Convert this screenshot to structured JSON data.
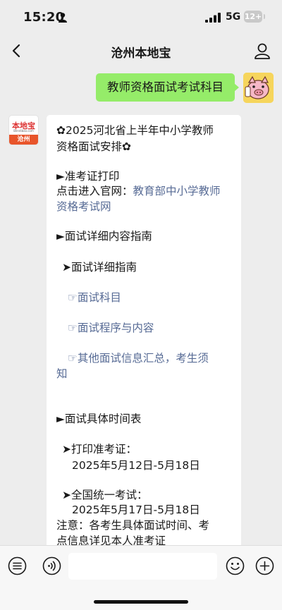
{
  "status_bar": {
    "time": "15:20",
    "network": "5G",
    "battery": "12+"
  },
  "nav": {
    "title": "沧州本地宝"
  },
  "user_message": "教师资格面试考试科目",
  "bot_avatar": {
    "logo_text": "本地宝",
    "logo_sub": "Bendibao.com",
    "city": "沧州"
  },
  "bot_message": {
    "lines": [
      "✿2025河北省上半年中小学教师",
      "资格面试安排✿",
      "►准考证打印",
      "点击进入官网：",
      "教育部中小学教师",
      "资格考试网",
      "►面试详细内容指南",
      "➤面试详细指南",
      "☞面试科目",
      "☞面试程序与内容",
      "☞其他面试信息汇总，考生须",
      "知",
      "►面试具体时间表",
      "➤打印准考证：",
      "2025年5月12日-5月18日",
      "➤全国统一考试：",
      "2025年5月17日-5月18日",
      "注意：各考生具体面试时间、考",
      "点信息详见本人准考证"
    ]
  },
  "input_bar": {
    "placeholder": ""
  },
  "colors": {
    "background": "#ededed",
    "user_bubble": "#95ec69",
    "link": "#576b95",
    "logo_orange": "#e8552b"
  }
}
